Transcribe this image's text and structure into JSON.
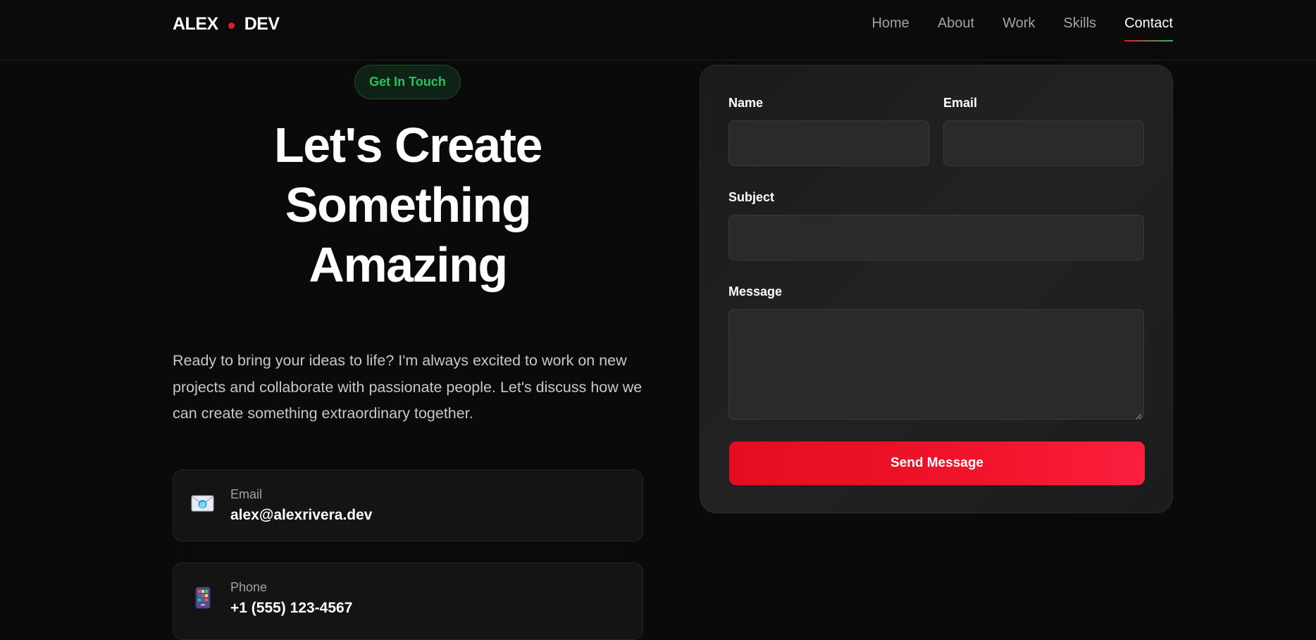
{
  "nav": {
    "logo_left": "ALEX",
    "logo_right": "DEV",
    "links": [
      {
        "label": "Home"
      },
      {
        "label": "About"
      },
      {
        "label": "Work"
      },
      {
        "label": "Skills"
      },
      {
        "label": "Contact"
      }
    ],
    "active_link": "Contact"
  },
  "hero": {
    "badge": "Get In Touch",
    "title_lines": [
      "Let's Create",
      "Something",
      "Amazing"
    ],
    "intro": "Ready to bring your ideas to life? I'm always excited to work on new projects and collaborate with passionate people. Let's discuss how we can create something extraordinary together."
  },
  "contact_info": [
    {
      "icon": "envelope-icon",
      "label": "Email",
      "value": "alex@alexrivera.dev"
    },
    {
      "icon": "phone-icon",
      "label": "Phone",
      "value": "+1 (555) 123-4567"
    }
  ],
  "form": {
    "name_label": "Name",
    "name_value": "",
    "email_label": "Email",
    "email_value": "",
    "subject_label": "Subject",
    "subject_value": "",
    "message_label": "Message",
    "message_value": "",
    "submit_label": "Send Message"
  },
  "colors": {
    "background": "#0a0a0a",
    "accent_red": "#e11d2a",
    "accent_green": "#22c55e"
  }
}
